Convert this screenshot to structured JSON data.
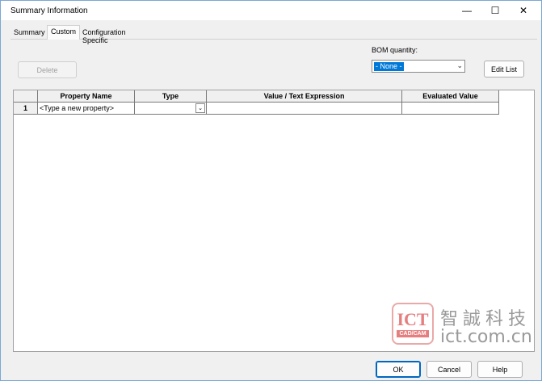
{
  "window": {
    "title": "Summary Information",
    "min_glyph": "—",
    "max_glyph": "☐",
    "close_glyph": "✕"
  },
  "tabs": [
    {
      "label": "Summary"
    },
    {
      "label": "Custom"
    },
    {
      "label": "Configuration Specific"
    }
  ],
  "toolbar": {
    "delete_label": "Delete",
    "bom_label": "BOM quantity:",
    "bom_value": "- None -",
    "edit_list_label": "Edit List"
  },
  "grid": {
    "columns": [
      "Property Name",
      "Type",
      "Value / Text Expression",
      "Evaluated Value"
    ],
    "rows": [
      {
        "num": "1",
        "property": "<Type a new property>",
        "type": "",
        "value": "",
        "evaluated": ""
      }
    ]
  },
  "footer": {
    "ok_label": "OK",
    "cancel_label": "Cancel",
    "help_label": "Help"
  },
  "watermark": {
    "ict": "ICT",
    "cadcam": "CAD/CAM",
    "chinese": "智誠科技",
    "url": "ict.com.cn"
  },
  "colors": {
    "accent": "#0067c0",
    "selection": "#0078d7",
    "watermark_red": "#e57f7f"
  }
}
